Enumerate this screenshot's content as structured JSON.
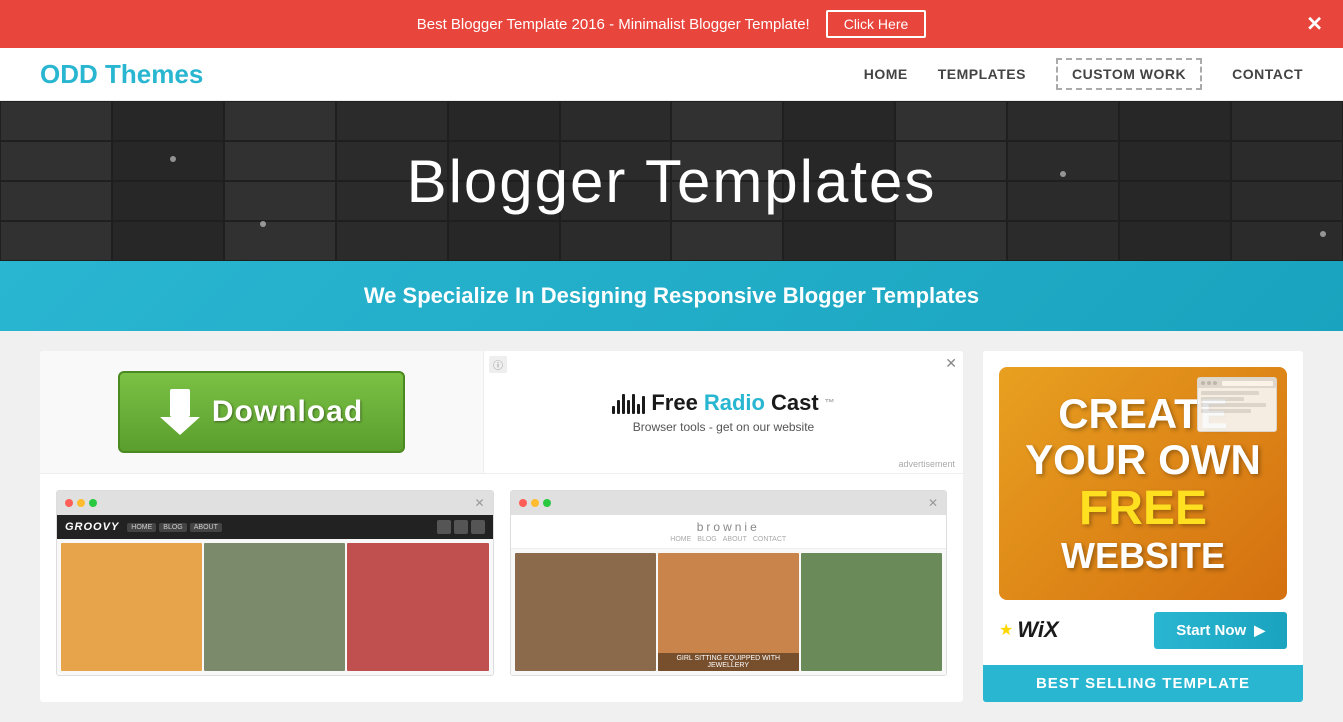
{
  "banner": {
    "text": "Best Blogger Template 2016 - Minimalist Blogger Template!",
    "cta_label": "Click Here",
    "close_label": "✕"
  },
  "header": {
    "logo_odd": "ODD",
    "logo_themes": "Themes",
    "nav": [
      {
        "label": "HOME",
        "id": "home",
        "active": false
      },
      {
        "label": "TEMPLATES",
        "id": "templates",
        "active": false
      },
      {
        "label": "CUSTOM WORK",
        "id": "custom-work",
        "active": true
      },
      {
        "label": "CONTACT",
        "id": "contact",
        "active": false
      }
    ]
  },
  "hero": {
    "title": "Blogger Templates"
  },
  "subheader": {
    "text": "We Specialize In Designing Responsive Blogger Templates"
  },
  "left_col": {
    "download": {
      "label": "Download"
    },
    "radio_ad": {
      "logo": "FreeRadioCast",
      "tagline": "Browser tools - get on our website",
      "advertisement": "advertisement"
    },
    "templates": [
      {
        "name": "Groovy",
        "type": "dark-header"
      },
      {
        "name": "Brownie",
        "type": "light-header"
      }
    ]
  },
  "right_col": {
    "wix_ad": {
      "create_label": "CREATE",
      "your_own_label": "YOUR OWN",
      "free_label": "FREE",
      "website_label": "WEBSITE",
      "logo_text": "WiX",
      "start_now_label": "Start Now"
    },
    "best_selling_label": "BEST SELLING TEMPLATE"
  }
}
